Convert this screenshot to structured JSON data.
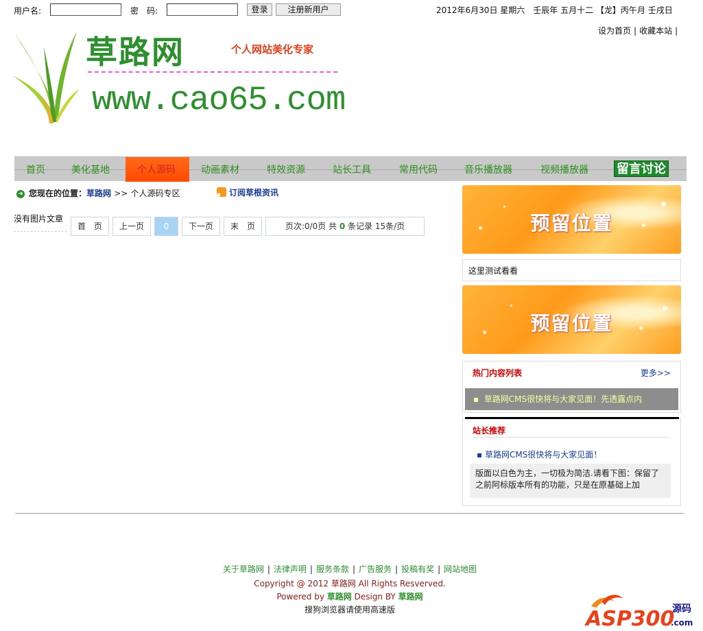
{
  "login": {
    "username_label": "用户名:",
    "password_label": "密　码:",
    "login_button": "登录",
    "register_button": "注册新用户"
  },
  "date_text": "2012年6月30日 星期六　壬辰年 五月十二 【龙】丙午月 壬戌日",
  "top_links": {
    "set_home": "设为首页",
    "bookmark": "收藏本站",
    "sep": "|"
  },
  "logo": {
    "title": "草路网",
    "slogan": "个人网站美化专家",
    "url": "www.cao65.com"
  },
  "nav": {
    "items": [
      "首页",
      "美化基地",
      "个人源码",
      "动画素材",
      "特效资源",
      "站长工具",
      "常用代码",
      "音乐播放器",
      "视频播放器"
    ],
    "active_index": 2,
    "special": "留言讨论"
  },
  "breadcrumb": {
    "prefix": "您现在的位置：",
    "home": "草路网",
    "sep": ">>",
    "current": "个人源码专区"
  },
  "rss_label": "订阅草根资讯",
  "content": {
    "empty_text": "没有图片文章"
  },
  "pager": {
    "first": "首　页",
    "prev": "上一页",
    "current": "0",
    "next": "下一页",
    "last": "末　页",
    "info_prefix": "页次:0/0页 共",
    "info_count": "0",
    "info_suffix": "条记录 15条/页"
  },
  "sidebar": {
    "banner_text": "预留位置",
    "test_text": "这里测试看看",
    "hot": {
      "title": "热门内容列表",
      "more": "更多>>",
      "item": "草路网CMS很快将与大家见面！先透露点内"
    },
    "recommend": {
      "title": "站长推荐",
      "link": "草路网CMS很快将与大家见面！",
      "desc": "版面以白色为主，一切极为简洁.请看下图：保留了之前阿标版本所有的功能，只是在原基础上加"
    }
  },
  "footer": {
    "links": [
      "关于草路网",
      "法律声明",
      "服务条款",
      "广告服务",
      "投稿有奖",
      "网站地图"
    ],
    "copyright": "Copyright @ 2012 草路网 All Rights Resverved.",
    "powered_prefix": "Powered by",
    "powered_name": "草路网",
    "design_prefix": "Design BY",
    "design_name": "草路网",
    "browser_tip": "搜狗浏览器请使用高速版"
  },
  "watermark": {
    "text": "ASP300",
    "suffix_cn": "源码",
    "suffix_dom": ".com"
  },
  "colors": {
    "brand_green": "#2e8f2e",
    "nav_active": "#ff5a0a",
    "link_blue": "#1a3c95",
    "hot_red": "#cc0000"
  }
}
